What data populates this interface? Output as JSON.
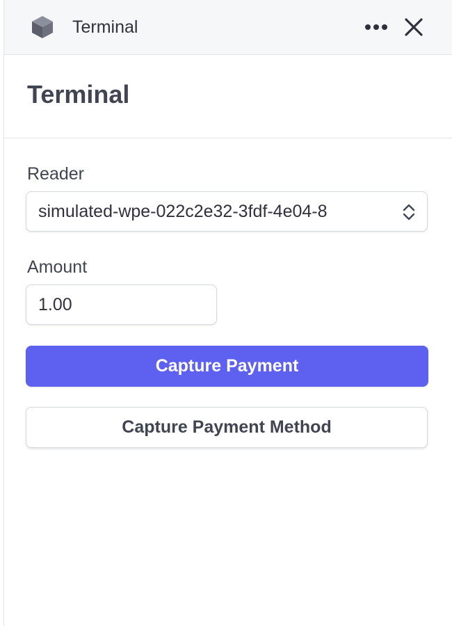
{
  "titlebar": {
    "icon": "cube-icon",
    "label": "Terminal",
    "more_icon": "more-horizontal-icon",
    "close_icon": "close-icon"
  },
  "header": {
    "title": "Terminal"
  },
  "form": {
    "reader": {
      "label": "Reader",
      "value": "simulated-wpe-022c2e32-3fdf-4e04-8",
      "icon": "chevron-up-down-icon"
    },
    "amount": {
      "label": "Amount",
      "value": "1.00"
    },
    "capture_payment_label": "Capture Payment",
    "capture_payment_method_label": "Capture Payment Method"
  },
  "colors": {
    "primary": "#5e61f0",
    "titlebar_bg": "#f6f7f9",
    "text": "#414552",
    "border": "#d5d8de"
  }
}
